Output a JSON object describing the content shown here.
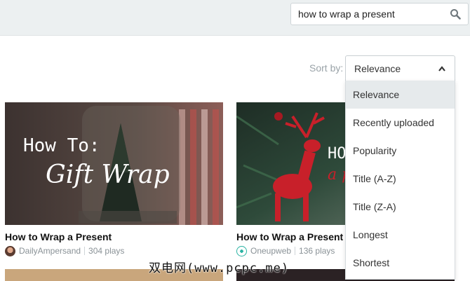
{
  "search": {
    "value": "how to wrap a present",
    "icon": "search-icon"
  },
  "sort": {
    "label": "Sort by:",
    "selected": "Relevance",
    "options": [
      "Relevance",
      "Recently uploaded",
      "Popularity",
      "Title (A-Z)",
      "Title (Z-A)",
      "Longest",
      "Shortest"
    ]
  },
  "videos": [
    {
      "thumb_line1": "How To:",
      "thumb_line2": "Gift Wrap",
      "title": "How to Wrap a Present",
      "author": "DailyAmpersand",
      "plays": "304 plays"
    },
    {
      "thumb_line1": "HO",
      "thumb_line2": "a p",
      "title": "How to Wrap a Present I",
      "author": "Oneupweb",
      "plays": "136 plays"
    }
  ],
  "watermark": "双电网(www.pcpc.me)",
  "colors": {
    "topbar": "#ecf0f1",
    "menu_active": "#e6eaec",
    "muted_text": "#8a9297"
  }
}
